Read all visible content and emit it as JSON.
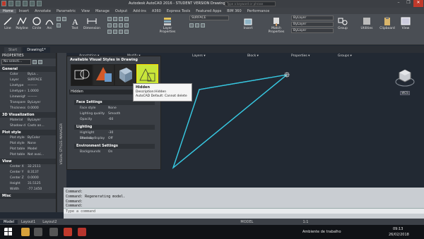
{
  "window": {
    "title": "Autodesk AutoCAD 2016 - STUDENT VERSION    Drawing1.dwg",
    "search_placeholder": "Type a keyword or phrase",
    "controls": [
      "–",
      "❐",
      "✕"
    ]
  },
  "ribbon_tabs": [
    "Home",
    "Insert",
    "Annotate",
    "Parametric",
    "View",
    "Manage",
    "Output",
    "Add-ins",
    "A360",
    "Express Tools",
    "Featured Apps",
    "BIM 360",
    "Performance"
  ],
  "ribbon": {
    "draw_tools": [
      "Line",
      "Polyline",
      "Circle",
      "Arc"
    ],
    "annotation_tools": [
      "Text",
      "Dimension"
    ],
    "layer_tools": [
      "Layer Properties"
    ],
    "layer_dropdown": "SURFACE",
    "block_tools": [
      "Insert"
    ],
    "properties_tools": [
      "Match Properties"
    ],
    "bylayer_1": "ByLayer",
    "bylayer_2": "ByLayer",
    "bylayer_3": "ByLayer",
    "right_tools": [
      "Group",
      "Utilities",
      "Clipboard",
      "View"
    ],
    "panel_labels": [
      "Draw ▾",
      "Modify ▾",
      "Annotation ▾",
      "Layers ▾",
      "Block ▾",
      "Properties ▾",
      "Groups ▾"
    ]
  },
  "doc_tabs": [
    "Start",
    "Drawing1*"
  ],
  "properties": {
    "header": "PROPERTIES",
    "selection": "No selecti...",
    "general_title": "General",
    "general": [
      [
        "Color",
        "ByLa..."
      ],
      [
        "Layer",
        "SURFACE"
      ],
      [
        "Linetype",
        "———"
      ],
      [
        "Linetype sc...",
        "1.0000"
      ],
      [
        "Lineweight",
        "———"
      ],
      [
        "Transparency",
        "ByLayer"
      ],
      [
        "Thickness",
        "0.0000"
      ]
    ],
    "viz3d_title": "3D Visualization",
    "viz3d": [
      [
        "Material",
        "ByLayer"
      ],
      [
        "Shadow dis...",
        "Casts an..."
      ]
    ],
    "plot_title": "Plot style",
    "plot": [
      [
        "Plot style",
        "ByColor"
      ],
      [
        "Plot style t...",
        "None"
      ],
      [
        "Plot table a...",
        "Model"
      ],
      [
        "Plot table t...",
        "Not avai..."
      ]
    ],
    "view_title": "View",
    "view": [
      [
        "Center X",
        "32.2111"
      ],
      [
        "Center Y",
        "8.3137"
      ],
      [
        "Center Z",
        "0.0000"
      ],
      [
        "Height",
        "31.5125"
      ],
      [
        "Width",
        "-77.1450"
      ]
    ],
    "misc_title": "Misc"
  },
  "visual_styles_manager": {
    "side_label": "VISUAL STYLES MANAGER",
    "palette_title": "Available Visual Styles in Drawing",
    "current_style": "Hidden",
    "face_settings_title": "Face Settings",
    "face_settings": [
      [
        "Face style",
        "None"
      ],
      [
        "Lighting quality",
        "Smooth"
      ],
      [
        "Opacity",
        "-60"
      ]
    ],
    "lighting_title": "Lighting",
    "lighting": [
      [
        "Highlight intensity",
        "-30"
      ],
      [
        "Shadow display",
        "Off"
      ]
    ],
    "environment_title": "Environment Settings",
    "environment": [
      [
        "Backgrounds",
        "On"
      ]
    ]
  },
  "tooltip": {
    "title": "Hidden",
    "line1": "Description:Hidden",
    "line2": "AutoCAD Default: Cannot delete"
  },
  "viewcube": {
    "label": "WCS"
  },
  "command_history": [
    "Command:",
    "Command:  Regenerating model.",
    "Command:",
    "Command:"
  ],
  "command_placeholder": "Type a command",
  "layout_tabs": [
    "Model",
    "Layout1",
    "Layout2"
  ],
  "status": {
    "model": "MODEL",
    "scale": "1:1"
  },
  "taskbar": {
    "network": "Ambiente de trabalho",
    "time": "09:13",
    "date": "26/02/2018"
  }
}
